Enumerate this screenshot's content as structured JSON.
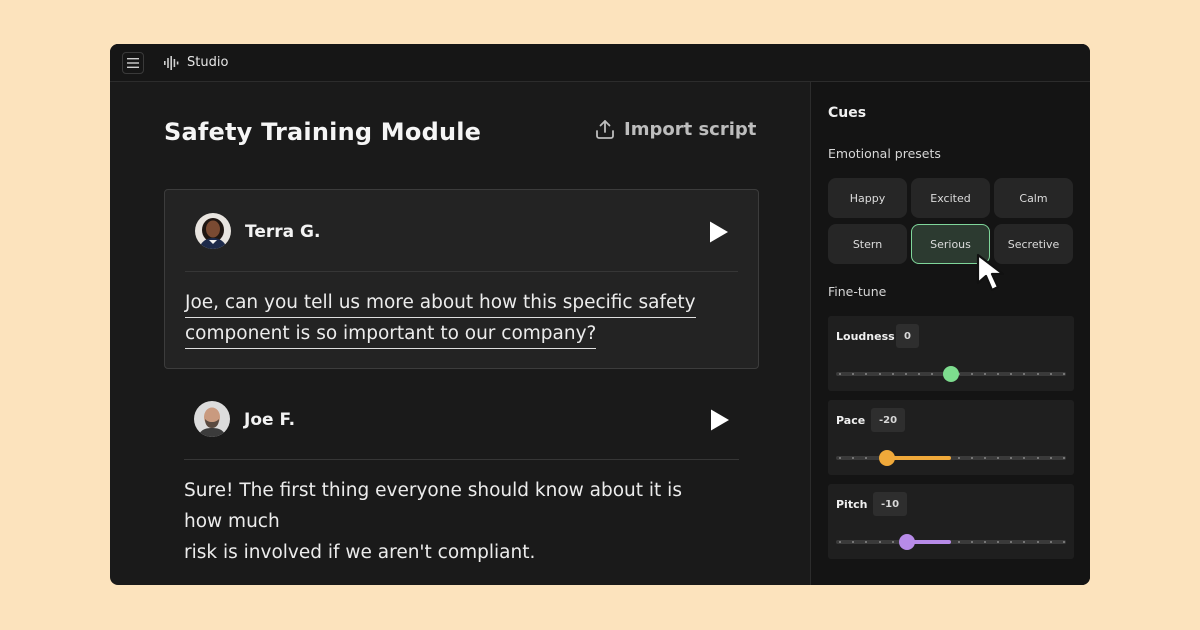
{
  "app": {
    "name": "Studio"
  },
  "main": {
    "title": "Safety Training Module",
    "import_label": "Import script",
    "lines": [
      {
        "speaker": "Terra G.",
        "text_lines": [
          "Joe, can you tell us more about how this specific safety",
          "component is so important to our company?"
        ]
      },
      {
        "speaker": "Joe F.",
        "text_lines": [
          "Sure! The first thing everyone should know about it is how much",
          "risk is involved if we aren't compliant."
        ]
      }
    ]
  },
  "cues": {
    "title": "Cues",
    "presets_label": "Emotional presets",
    "presets": [
      "Happy",
      "Excited",
      "Calm",
      "Stern",
      "Serious",
      "Secretive"
    ],
    "selected_preset": "Serious",
    "finetune_label": "Fine-tune",
    "sliders": [
      {
        "label": "Loudness",
        "value": "0",
        "position": 0.5,
        "color": "#7ddc8e"
      },
      {
        "label": "Pace",
        "value": "-20",
        "position": 0.22,
        "color": "#f0a93a"
      },
      {
        "label": "Pitch",
        "value": "-10",
        "position": 0.31,
        "color": "#b78be8"
      }
    ]
  },
  "colors": {
    "background": "#fce3bd",
    "window": "#1a1a1a",
    "selected_border": "#7fd69a"
  }
}
